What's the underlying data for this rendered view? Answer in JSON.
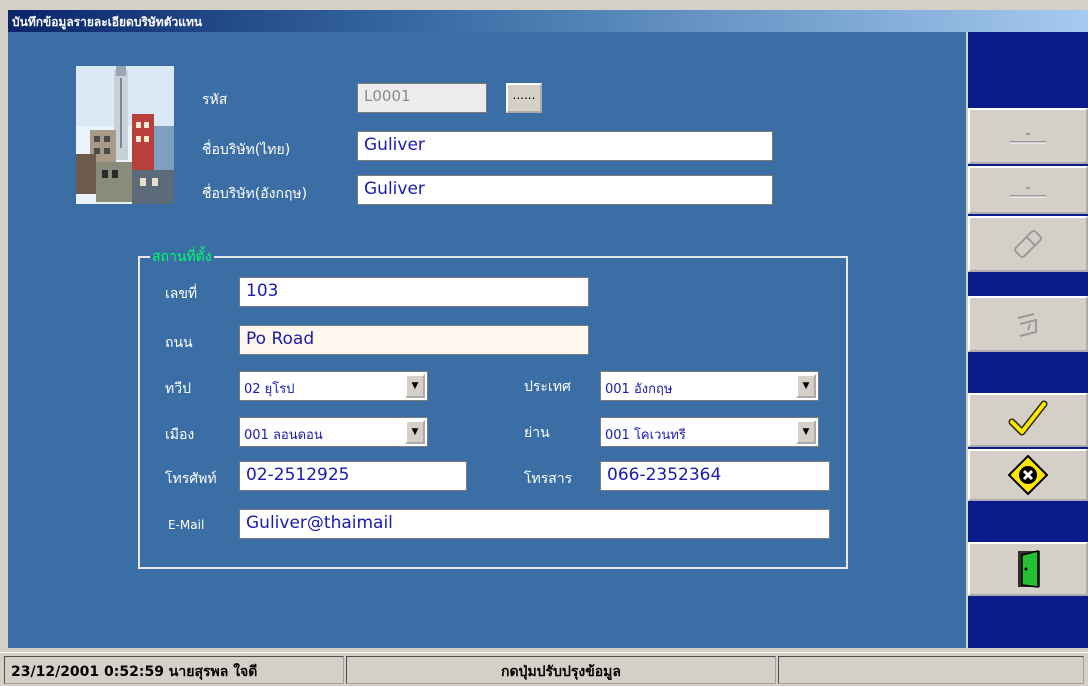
{
  "window": {
    "title": "บันทึกข้อมูลรายละเอียดบริษัทตัวแทน"
  },
  "form": {
    "code_label": "รหัส",
    "code_value": "L0001",
    "lookup_button_label": "......",
    "name_th_label": "ชื่อบริษัท(ไทย)",
    "name_th_value": "Guliver",
    "name_en_label": "ชื่อบริษัท(อังกฤษ)",
    "name_en_value": "Guliver"
  },
  "location": {
    "group_title": "สถานที่ตั้ง",
    "address_no_label": "เลขที่",
    "address_no_value": "103",
    "road_label": "ถนน",
    "road_value": "Po Road",
    "continent_label": "ทวีป",
    "continent_value": "02 ยุโรป",
    "country_label": "ประเทศ",
    "country_value": "001 อังกฤษ",
    "city_label": "เมือง",
    "city_value": "001 ลอนดอน",
    "district_label": "ย่าน",
    "district_value": "001 โคเวนทรี",
    "phone_label": "โทรศัพท์",
    "phone_value": "02-2512925",
    "fax_label": "โทรสาร",
    "fax_value": "066-2352364",
    "email_label": "E-Mail",
    "email_value": "Guliver@thaimail"
  },
  "toolbar": {
    "buttons": [
      {
        "icon": "add-record-icon"
      },
      {
        "icon": "insert-record-icon"
      },
      {
        "icon": "eraser-icon"
      },
      {
        "icon": "search-hand-icon"
      },
      {
        "icon": "checkmark-icon"
      },
      {
        "icon": "cancel-icon"
      },
      {
        "icon": "exit-door-icon"
      }
    ]
  },
  "status": {
    "datetime_user": "23/12/2001 0:52:59 นายสุรพล  ใจดี",
    "hint": "กดปุ่มปรับปรุงข้อมูล",
    "extra": ""
  },
  "colors": {
    "form_background": "#3a6ea5",
    "right_panel": "#0a1b8c",
    "group_title": "#00ff66",
    "field_text": "#1a1ab0"
  }
}
